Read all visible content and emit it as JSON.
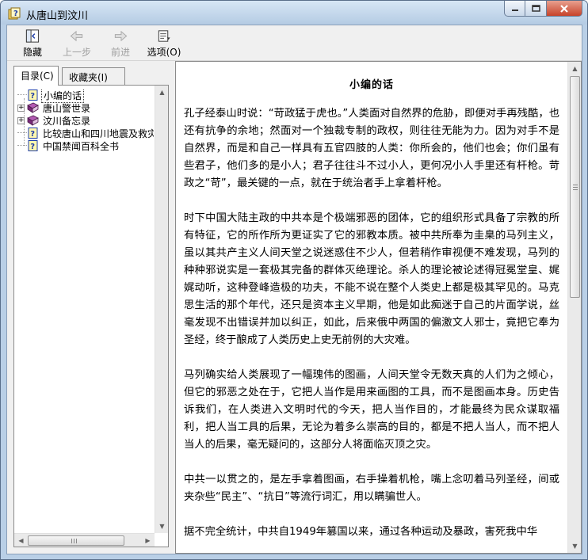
{
  "window": {
    "title": "从唐山到汶川"
  },
  "toolbar": {
    "hide_label": "隐藏",
    "back_label": "上一步",
    "forward_label": "前进",
    "options_label": "选项(O)"
  },
  "nav": {
    "tab_toc": "目录(C)",
    "tab_favorites": "收藏夹(I)",
    "tree": [
      {
        "label": "小编的话",
        "type": "page",
        "expandable": false,
        "selected": true
      },
      {
        "label": "唐山警世录",
        "type": "book",
        "expandable": true,
        "selected": false
      },
      {
        "label": "汶川备忘录",
        "type": "book",
        "expandable": true,
        "selected": false
      },
      {
        "label": "比较唐山和四川地震及救灾",
        "type": "page",
        "expandable": false,
        "selected": false
      },
      {
        "label": "中国禁闻百科全书",
        "type": "page",
        "expandable": false,
        "selected": false
      }
    ]
  },
  "content": {
    "heading": "小编的话",
    "paragraphs": [
      "孔子经泰山时说：“苛政猛于虎也。”人类面对自然界的危胁，即便对手再残酷，也还有抗争的余地；然面对一个独裁专制的政权，则往往无能为力。因为对手不是自然界，而是和自己一样具有五官四肢的人类：你所会的，他们也会；你们虽有些君子，他们多的是小人；君子往往斗不过小人，更何况小人手里还有杆枪。苛政之“苛”，最关键的一点，就在于统治者手上拿着杆枪。",
      "时下中国大陆主政的中共本是个极端邪恶的团体，它的组织形式具备了宗教的所有特征，它的所作所为更证实了它的邪教本质。被中共所奉为圭臬的马列主义，虽以其共产主义人间天堂之说迷惑住不少人，但若稍作审视便不难发现，马列的种种邪说实是一套极其完备的群体灭绝理论。杀人的理论被论述得冠冕堂皇、娓娓动听，这种登峰造极的功夫，不能不说在整个人类史上都是极其罕见的。马克思生活的那个年代，还只是资本主义早期，他是如此痴迷于自己的片面学说，丝毫发现不出错误并加以纠正，如此，后来俄中两国的偏激文人邪士，竟把它奉为圣经，终于酿成了人类历史上史无前例的大灾难。",
      "马列确实给人类展现了一幅瑰伟的图画，人间天堂令无数天真的人们为之倾心，但它的邪恶之处在于，它把人当作是用来画图的工具，而不是图画本身。历史告诉我们，在人类进入文明时代的今天，把人当作目的，才能最终为民众谋取福利，把人当工具的后果，无论为着多么崇高的目的，都是不把人当人，而不把人当人的后果，毫无疑问的，这部分人将面临灭顶之灾。",
      "中共一以贯之的，是左手拿着图画，右手操着机枪，嘴上念叨着马列圣经，间或夹杂些“民主”、“抗日”等流行词汇，用以瞒骗世人。",
      "据不完全统计，中共自1949年篡国以来，通过各种运动及暴政，害死我中华"
    ]
  },
  "colors": {
    "titlebar": "#c3d6ec",
    "close_button": "#c7432a",
    "book_icon": "#8a3a8a",
    "page_icon": "#1f3fa8"
  }
}
